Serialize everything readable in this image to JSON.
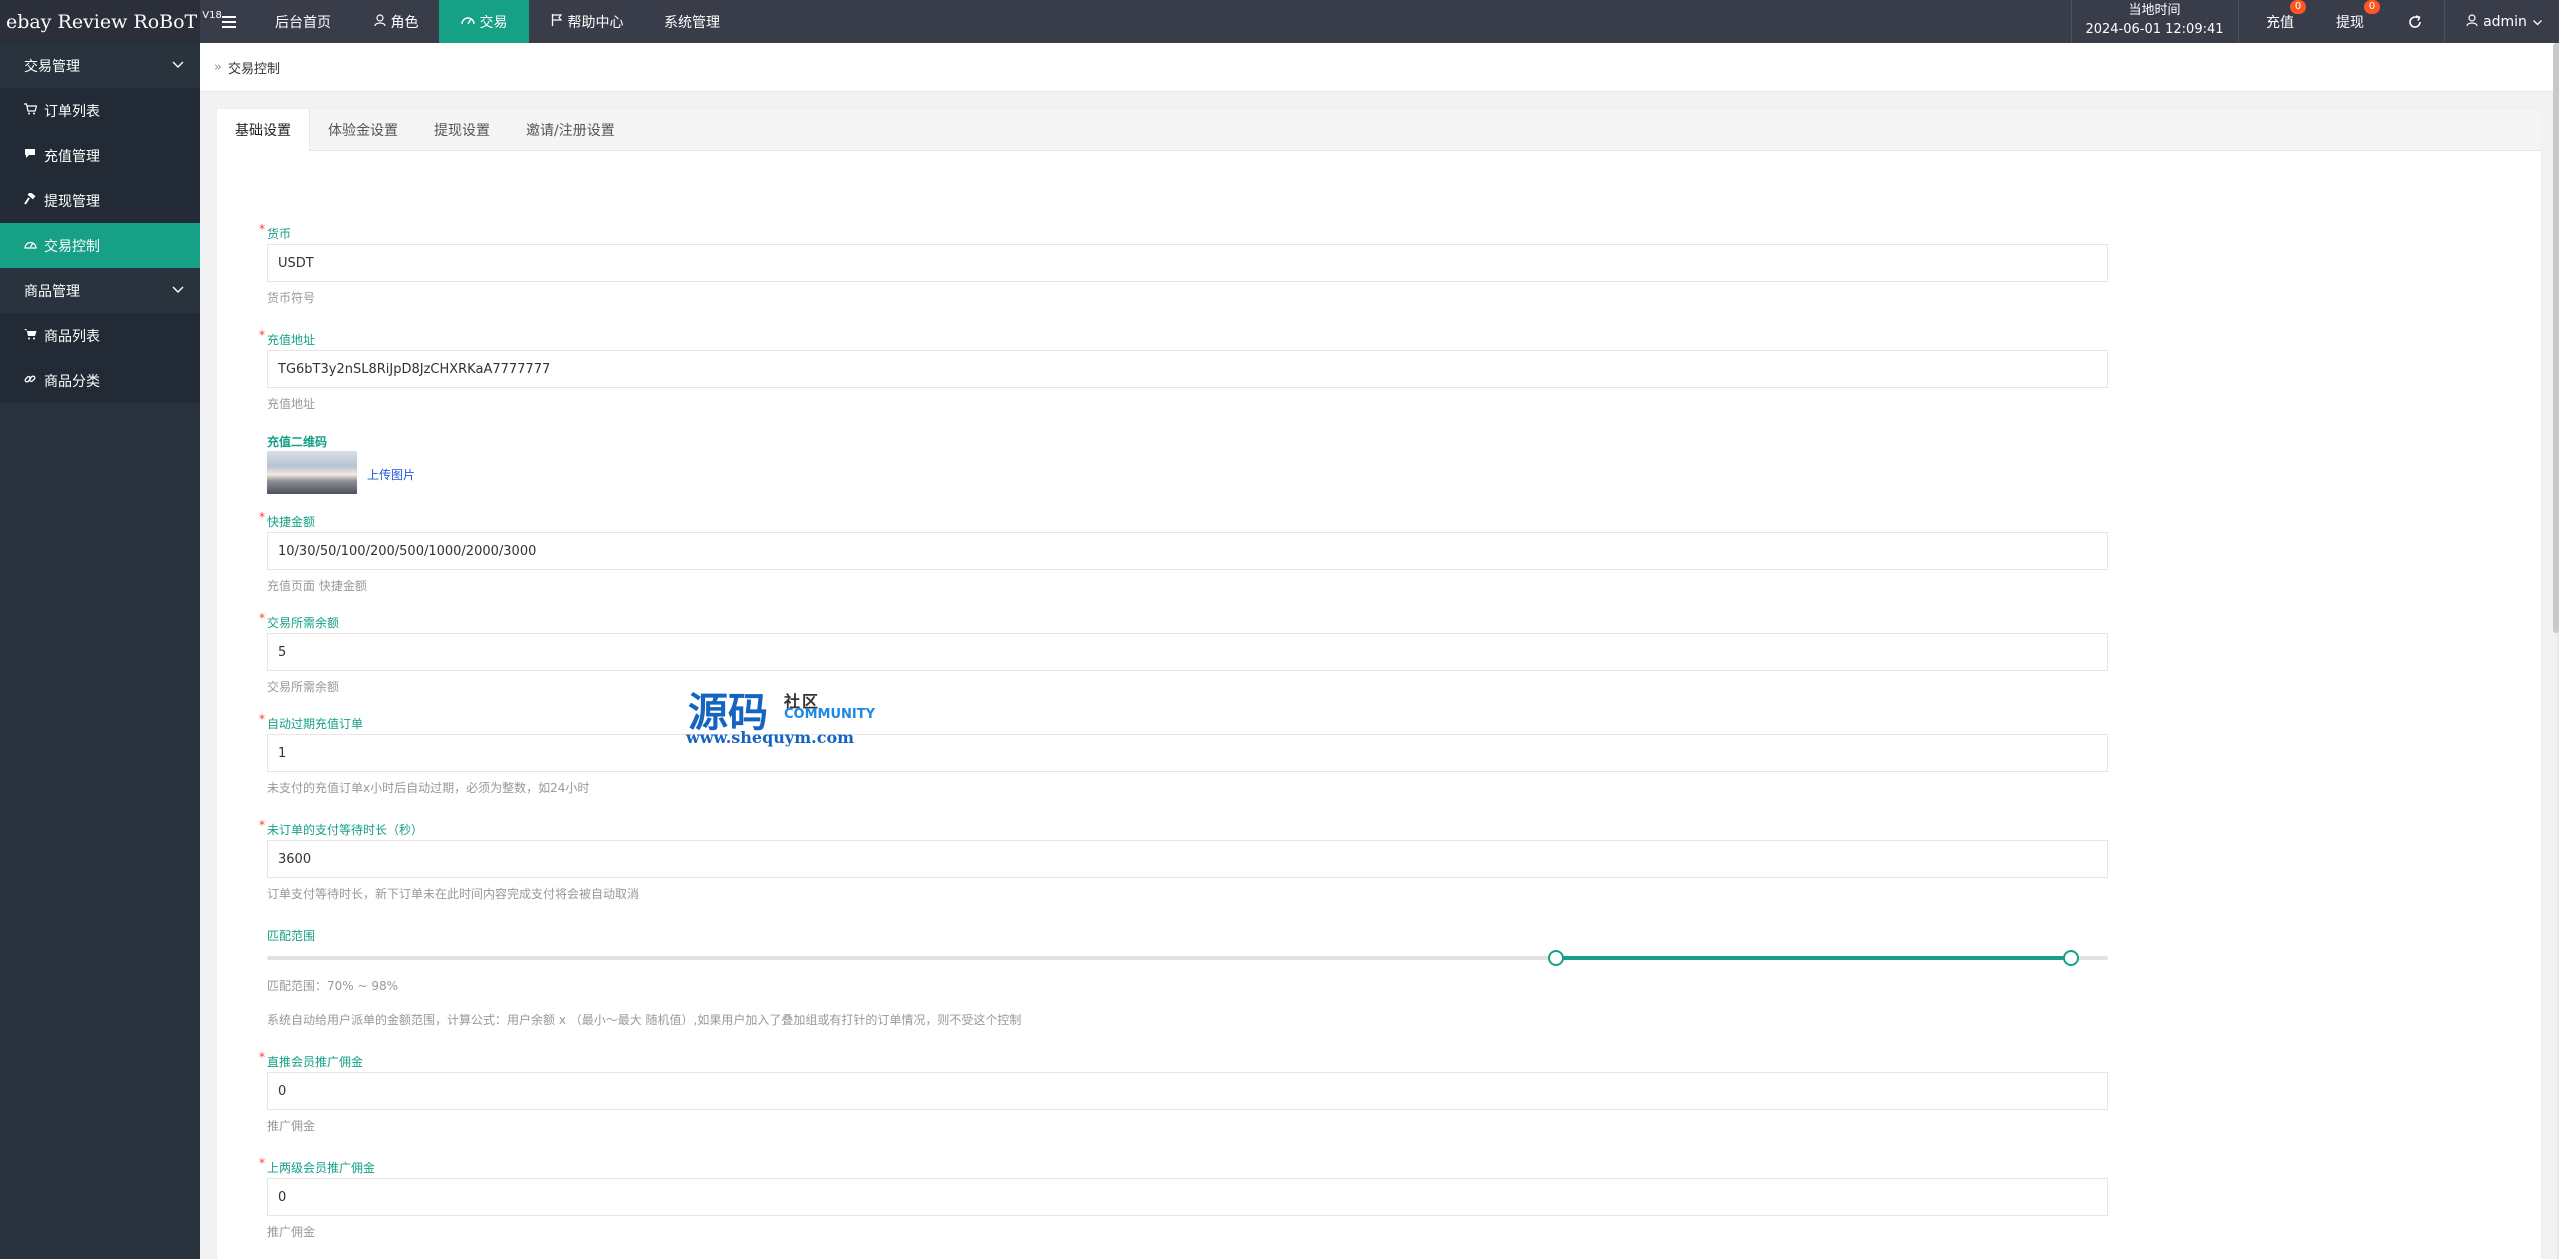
{
  "brand": {
    "title": "ebay Review RoBoT",
    "version": "V18"
  },
  "topnav": {
    "items": [
      {
        "label": "后台首页"
      },
      {
        "label": "角色"
      },
      {
        "label": "交易"
      },
      {
        "label": "帮助中心"
      },
      {
        "label": "系统管理"
      }
    ],
    "clock_label": "当地时间",
    "clock_value": "2024-06-01 12:09:41",
    "recharge_label": "充值",
    "recharge_badge": "0",
    "withdraw_label": "提现",
    "withdraw_badge": "0",
    "user": "admin"
  },
  "sidebar": {
    "groups": [
      {
        "label": "交易管理",
        "items": [
          {
            "label": "订单列表"
          },
          {
            "label": "充值管理"
          },
          {
            "label": "提现管理"
          },
          {
            "label": "交易控制"
          }
        ]
      },
      {
        "label": "商品管理",
        "items": [
          {
            "label": "商品列表"
          },
          {
            "label": "商品分类"
          }
        ]
      }
    ]
  },
  "breadcrumb": {
    "current": "交易控制"
  },
  "tabs": [
    "基础设置",
    "体验金设置",
    "提现设置",
    "邀请/注册设置"
  ],
  "form": {
    "currency": {
      "label": "货币",
      "value": "USDT",
      "hint": "货币符号"
    },
    "recharge_address": {
      "label": "充值地址",
      "value": "TG6bT3y2nSL8RiJpD8JzCHXRKaA7777777",
      "hint": "充值地址"
    },
    "qr": {
      "label": "充值二维码",
      "upload": "上传图片"
    },
    "quick_amounts": {
      "label": "快捷金额",
      "value": "10/30/50/100/200/500/1000/2000/3000",
      "hint": "充值页面 快捷金额"
    },
    "required_balance": {
      "label": "交易所需余额",
      "value": "5",
      "hint": "交易所需余额"
    },
    "auto_expire": {
      "label": "自动过期充值订单",
      "value": "1",
      "hint": "未支付的充值订单x小时后自动过期，必须为整数，如24小时"
    },
    "pay_wait": {
      "label": "未订单的支付等待时长（秒）",
      "value": "3600",
      "hint": "订单支付等待时长，新下订单未在此时间内容完成支付将会被自动取消"
    },
    "match_range": {
      "label": "匹配范围",
      "min": 70,
      "max": 98,
      "value_text": "匹配范围：70% ~ 98%",
      "hint": "系统自动给用户派单的金额范围，计算公式：用户余额 x （最小～最大 随机值）,如果用户加入了叠加组或有打针的订单情况，则不受这个控制"
    },
    "direct_commission": {
      "label": "直推会员推广佣金",
      "value": "0",
      "hint": "推广佣金"
    },
    "upper_commission": {
      "label": "上两级会员推广佣金",
      "value": "0",
      "hint": "推广佣金"
    }
  },
  "watermark": {
    "big": "源码",
    "cn": "社区",
    "en": "COMMUNITY",
    "url": "www.shequym.com"
  }
}
